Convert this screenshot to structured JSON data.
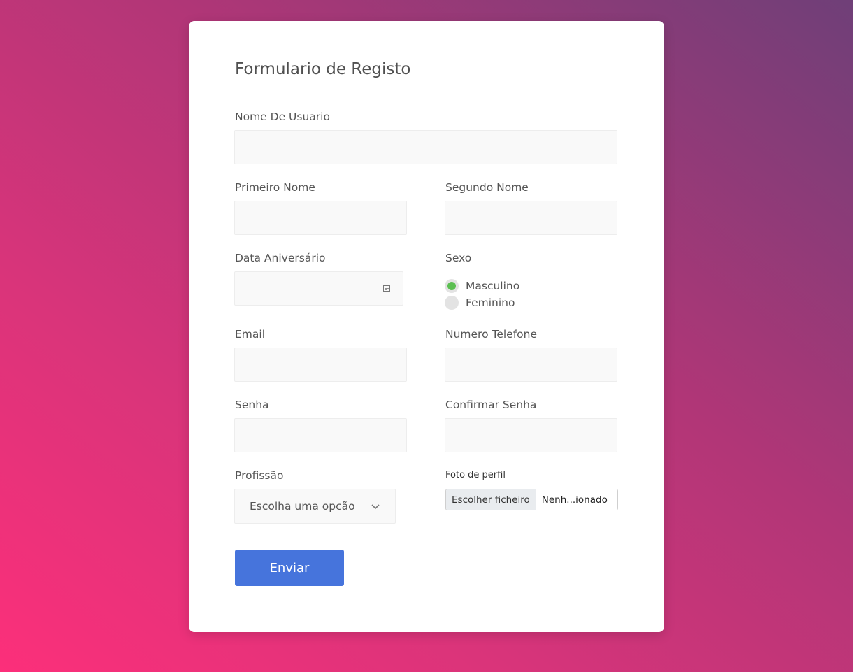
{
  "form": {
    "title": "Formulario de Registo",
    "username": {
      "label": "Nome De Usuario",
      "value": ""
    },
    "first_name": {
      "label": "Primeiro Nome",
      "value": ""
    },
    "last_name": {
      "label": "Segundo Nome",
      "value": ""
    },
    "birthday": {
      "label": "Data Aniversário",
      "value": "",
      "icon": "calendar-icon"
    },
    "gender": {
      "label": "Sexo",
      "options": [
        {
          "label": "Masculino",
          "checked": true
        },
        {
          "label": "Feminino",
          "checked": false
        }
      ],
      "checked_color": "#5cbf52"
    },
    "email": {
      "label": "Email",
      "value": ""
    },
    "phone": {
      "label": "Numero Telefone",
      "value": ""
    },
    "password": {
      "label": "Senha",
      "value": ""
    },
    "confirm_password": {
      "label": "Confirmar Senha",
      "value": ""
    },
    "profession": {
      "label": "Profissão",
      "selected": "Escolha uma opcão",
      "icon": "chevron-down-icon"
    },
    "profile_photo": {
      "label": "Foto de perfil",
      "button_label": "Escolher ficheiro",
      "file_name": "Nenh...ionado"
    },
    "submit_label": "Enviar"
  },
  "colors": {
    "accent": "#4674dc",
    "background_gradient_start": "#fc2f7a",
    "background_gradient_end": "#6f3f78"
  }
}
